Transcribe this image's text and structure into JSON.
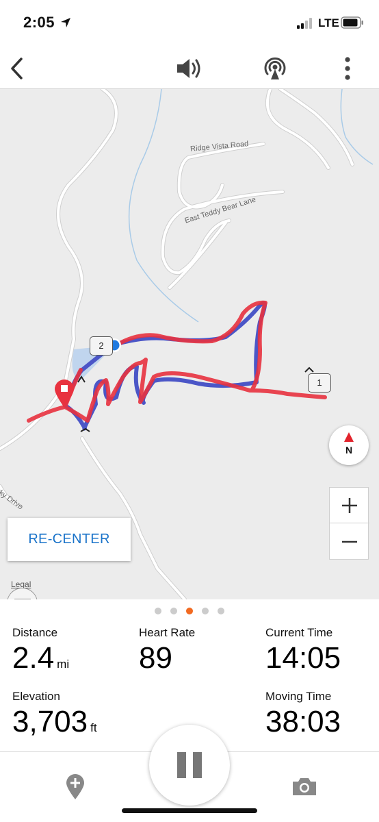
{
  "status_bar": {
    "time": "2:05",
    "network": "LTE",
    "icons": [
      "location-arrow-icon",
      "signal-icon",
      "battery-icon"
    ]
  },
  "nav": {
    "icons": [
      "back-chevron-icon",
      "speaker-icon",
      "live-broadcast-icon",
      "more-vertical-icon"
    ]
  },
  "map": {
    "road_labels": [
      "Ridge Vista Road",
      "East Teddy Bear Lane",
      "ky Drive"
    ],
    "markers": [
      "1",
      "2"
    ],
    "compass_label": "N",
    "recenter_label": "RE-CENTER",
    "legal_label": "Legal",
    "colors": {
      "track_red": "#e8323f",
      "track_blue": "#4b56c7",
      "accent_blue": "#1a73c9",
      "background": "#ececec"
    }
  },
  "pager": {
    "count": 5,
    "active_index": 2,
    "active_color": "#f26a21"
  },
  "stats": {
    "distance": {
      "label": "Distance",
      "value": "2.4",
      "unit": "mi"
    },
    "heart_rate": {
      "label": "Heart Rate",
      "value": "89"
    },
    "current_time": {
      "label": "Current Time",
      "value": "14:05"
    },
    "elevation": {
      "label": "Elevation",
      "value": "3,703",
      "unit": "ft"
    },
    "moving_time": {
      "label": "Moving Time",
      "value": "38:03"
    }
  },
  "bottom_bar": {
    "icons": [
      "add-waypoint-icon",
      "pause-icon",
      "camera-icon"
    ]
  }
}
